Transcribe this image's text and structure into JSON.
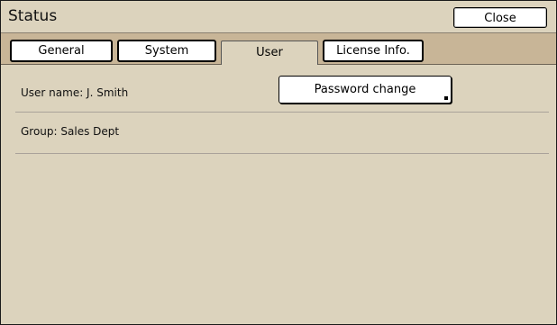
{
  "window": {
    "title": "Status",
    "close_label": "Close"
  },
  "tabs": [
    {
      "label": "General",
      "active": false
    },
    {
      "label": "System",
      "active": false
    },
    {
      "label": "User",
      "active": true
    },
    {
      "label": "License Info.",
      "active": false
    }
  ],
  "user": {
    "user_name_line": "User name: J. Smith",
    "group_line": "Group: Sales Dept",
    "password_change_label": "Password change"
  },
  "colors": {
    "background": "#dcd3bd",
    "tabstrip": "#c8b597"
  }
}
